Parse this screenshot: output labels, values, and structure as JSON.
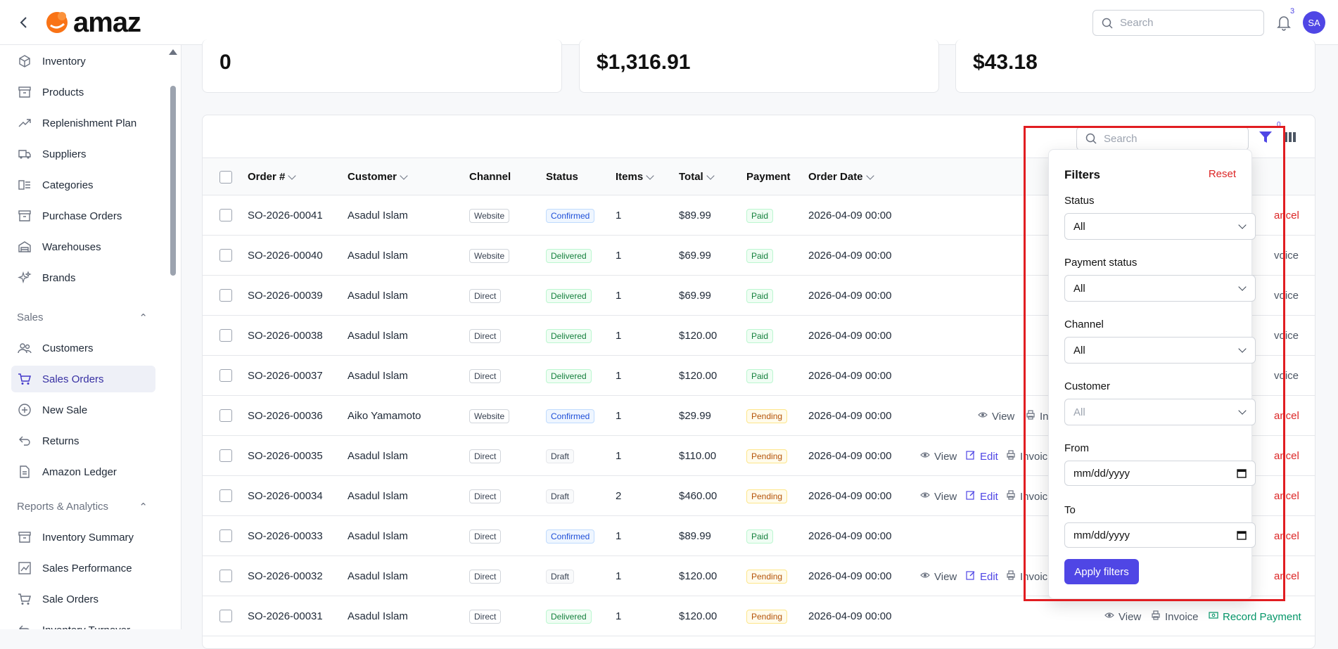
{
  "header": {
    "logo_text": "amaz",
    "search_placeholder": "Search",
    "notification_count": "3",
    "avatar_initials": "SA"
  },
  "sidebar": {
    "items_top": [
      {
        "label": "Inventory",
        "icon": "box-icon"
      },
      {
        "label": "Products",
        "icon": "archive-icon"
      },
      {
        "label": "Replenishment Plan",
        "icon": "trend-up-icon"
      },
      {
        "label": "Suppliers",
        "icon": "truck-icon"
      },
      {
        "label": "Categories",
        "icon": "category-icon"
      },
      {
        "label": "Purchase Orders",
        "icon": "archive-icon"
      },
      {
        "label": "Warehouses",
        "icon": "warehouse-icon"
      },
      {
        "label": "Brands",
        "icon": "sparkle-icon"
      }
    ],
    "sales_section": "Sales",
    "sales_items": [
      {
        "label": "Customers",
        "icon": "users-icon"
      },
      {
        "label": "Sales Orders",
        "icon": "cart-icon"
      },
      {
        "label": "New Sale",
        "icon": "plus-circle-icon"
      },
      {
        "label": "Returns",
        "icon": "return-icon"
      },
      {
        "label": "Amazon Ledger",
        "icon": "document-icon"
      }
    ],
    "reports_section": "Reports & Analytics",
    "reports_items": [
      {
        "label": "Inventory Summary",
        "icon": "archive-icon"
      },
      {
        "label": "Sales Performance",
        "icon": "chart-icon"
      },
      {
        "label": "Sale Orders",
        "icon": "cart-icon"
      },
      {
        "label": "Inventory Turnover",
        "icon": "return-icon"
      }
    ],
    "active": "Sales Orders"
  },
  "stats": [
    "0",
    "$1,316.91",
    "$43.18"
  ],
  "table": {
    "search_placeholder": "Search",
    "filter_count": "0",
    "columns": [
      "Order #",
      "Customer",
      "Channel",
      "Status",
      "Items",
      "Total",
      "Payment",
      "Order Date"
    ],
    "rows": [
      {
        "order": "SO-2026-00041",
        "customer": "Asadul Islam",
        "channel": "Website",
        "status": "Confirmed",
        "items": "1",
        "total": "$89.99",
        "payment": "Paid",
        "date": "2026-04-09 00:00",
        "action": "ancel"
      },
      {
        "order": "SO-2026-00040",
        "customer": "Asadul Islam",
        "channel": "Website",
        "status": "Delivered",
        "items": "1",
        "total": "$69.99",
        "payment": "Paid",
        "date": "2026-04-09 00:00",
        "action": "voice"
      },
      {
        "order": "SO-2026-00039",
        "customer": "Asadul Islam",
        "channel": "Direct",
        "status": "Delivered",
        "items": "1",
        "total": "$69.99",
        "payment": "Paid",
        "date": "2026-04-09 00:00",
        "action": "voice"
      },
      {
        "order": "SO-2026-00038",
        "customer": "Asadul Islam",
        "channel": "Direct",
        "status": "Delivered",
        "items": "1",
        "total": "$120.00",
        "payment": "Paid",
        "date": "2026-04-09 00:00",
        "action": "voice"
      },
      {
        "order": "SO-2026-00037",
        "customer": "Asadul Islam",
        "channel": "Direct",
        "status": "Delivered",
        "items": "1",
        "total": "$120.00",
        "payment": "Paid",
        "date": "2026-04-09 00:00",
        "action": "voice"
      },
      {
        "order": "SO-2026-00036",
        "customer": "Aiko Yamamoto",
        "channel": "Website",
        "status": "Confirmed",
        "items": "1",
        "total": "$29.99",
        "payment": "Pending",
        "date": "2026-04-09 00:00",
        "action": "ancel"
      },
      {
        "order": "SO-2026-00035",
        "customer": "Asadul Islam",
        "channel": "Direct",
        "status": "Draft",
        "items": "1",
        "total": "$110.00",
        "payment": "Pending",
        "date": "2026-04-09 00:00",
        "action": "ancel"
      },
      {
        "order": "SO-2026-00034",
        "customer": "Asadul Islam",
        "channel": "Direct",
        "status": "Draft",
        "items": "2",
        "total": "$460.00",
        "payment": "Pending",
        "date": "2026-04-09 00:00",
        "action": "ancel"
      },
      {
        "order": "SO-2026-00033",
        "customer": "Asadul Islam",
        "channel": "Direct",
        "status": "Confirmed",
        "items": "1",
        "total": "$89.99",
        "payment": "Paid",
        "date": "2026-04-09 00:00",
        "action": "ancel"
      },
      {
        "order": "SO-2026-00032",
        "customer": "Asadul Islam",
        "channel": "Direct",
        "status": "Draft",
        "items": "1",
        "total": "$120.00",
        "payment": "Pending",
        "date": "2026-04-09 00:00",
        "action": "ancel"
      },
      {
        "order": "SO-2026-00031",
        "customer": "Asadul Islam",
        "channel": "Direct",
        "status": "Delivered",
        "items": "1",
        "total": "$120.00",
        "payment": "Pending",
        "date": "2026-04-09 00:00",
        "action": ""
      }
    ],
    "actions": {
      "view": "View",
      "edit": "Edit",
      "invoice": "Invoice",
      "inv_short": "Inv",
      "invoic": "Invoic",
      "record_payment": "Record Payment"
    }
  },
  "filters": {
    "title": "Filters",
    "reset": "Reset",
    "status_label": "Status",
    "status_value": "All",
    "payment_label": "Payment status",
    "payment_value": "All",
    "channel_label": "Channel",
    "channel_value": "All",
    "customer_label": "Customer",
    "customer_value": "All",
    "from_label": "From",
    "from_value": "mm/dd/yyyy",
    "to_label": "To",
    "to_value": "mm/dd/yyyy",
    "apply": "Apply filters"
  },
  "colors": {
    "accent": "#4f46e5",
    "highlight": "#e11d21"
  }
}
